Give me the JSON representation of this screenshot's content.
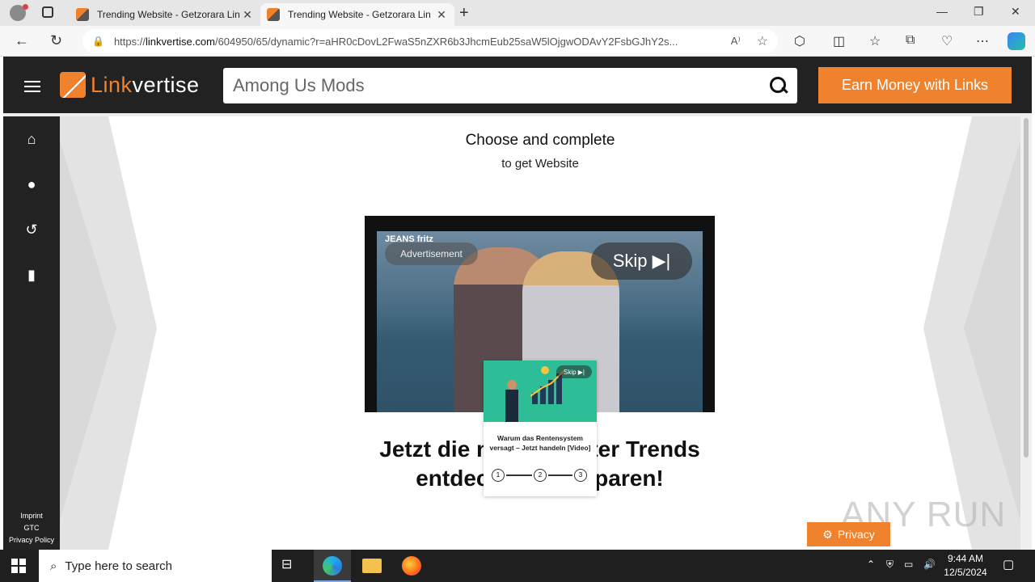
{
  "browser": {
    "tabs": [
      {
        "title": "Trending Website - Getzorara Lin"
      },
      {
        "title": "Trending Website - Getzorara Lin"
      }
    ],
    "url_prefix": "https://",
    "url_host": "linkvertise.com",
    "url_rest": "/604950/65/dynamic?r=aHR0cDovL2FwaS5nZXR6b3JhcmEub25saW5lOjgwODAvY2FsbGJhY2s..."
  },
  "header": {
    "logo_link": "Link",
    "logo_vertise": "vertise",
    "search_value": "Among Us Mods",
    "earn_button": "Earn Money with Links"
  },
  "sidebar": {
    "links": [
      "Imprint",
      "GTC",
      "Privacy Policy"
    ]
  },
  "main": {
    "title": "Choose and complete",
    "subtitle": "to get Website"
  },
  "ad": {
    "brand": "JEANS fritz",
    "advertisement_label": "Advertisement",
    "skip_label": "Skip ▶|",
    "headline": "Jetzt die neuen Winter Trends entdecken und sparen!"
  },
  "popup": {
    "skip_label": "Skip ▶|",
    "title": "Warum das Rentensystem versagt – Jetzt handeln [Video]",
    "steps": [
      "1",
      "2",
      "3"
    ]
  },
  "privacy_button": "Privacy",
  "watermark": "ANY RUN",
  "taskbar": {
    "search_placeholder": "Type here to search",
    "time": "9:44 AM",
    "date": "12/5/2024"
  },
  "colors": {
    "accent": "#f0822d",
    "header_bg": "#222222"
  }
}
